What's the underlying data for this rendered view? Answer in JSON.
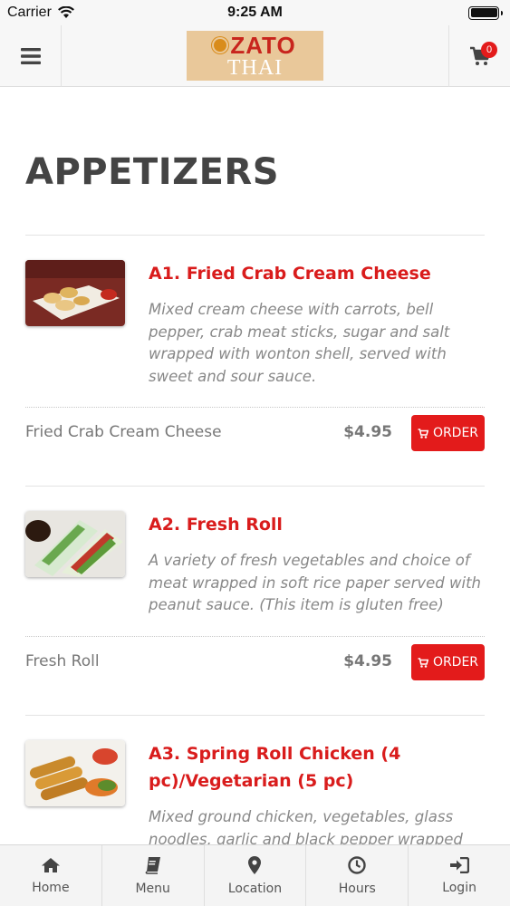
{
  "status_bar": {
    "carrier": "Carrier",
    "time": "9:25 AM"
  },
  "header": {
    "logo_top": "ZATO",
    "logo_bottom": "THAI",
    "cart_count": "0"
  },
  "section": {
    "title": "APPETIZERS"
  },
  "items": [
    {
      "title": "A1. Fried Crab Cream Cheese",
      "description": "Mixed cream cheese with carrots, bell pepper, crab meat sticks, sugar and salt wrapped with wonton shell, served with sweet and sour sauce.",
      "variant_name": "Fried Crab Cream Cheese",
      "price": "$4.95",
      "order_label": "ORDER"
    },
    {
      "title": "A2. Fresh Roll",
      "description": "A variety of fresh vegetables and choice of meat wrapped in soft rice paper served with peanut sauce. (This item is gluten free)",
      "variant_name": "Fresh Roll",
      "price": "$4.95",
      "order_label": "ORDER"
    },
    {
      "title": "A3. Spring Roll Chicken (4 pc)/Vegetarian (5 pc)",
      "description": "Mixed ground chicken, vegetables, glass noodles, garlic and black pepper wrapped with"
    }
  ],
  "tabs": [
    {
      "label": "Home",
      "icon": "home-icon"
    },
    {
      "label": "Menu",
      "icon": "book-icon"
    },
    {
      "label": "Location",
      "icon": "map-pin-icon"
    },
    {
      "label": "Hours",
      "icon": "clock-icon"
    },
    {
      "label": "Login",
      "icon": "login-icon"
    }
  ],
  "colors": {
    "accent": "#e31b1b",
    "title_red": "#d91c1c",
    "header_bg": "#f7f7f7"
  }
}
